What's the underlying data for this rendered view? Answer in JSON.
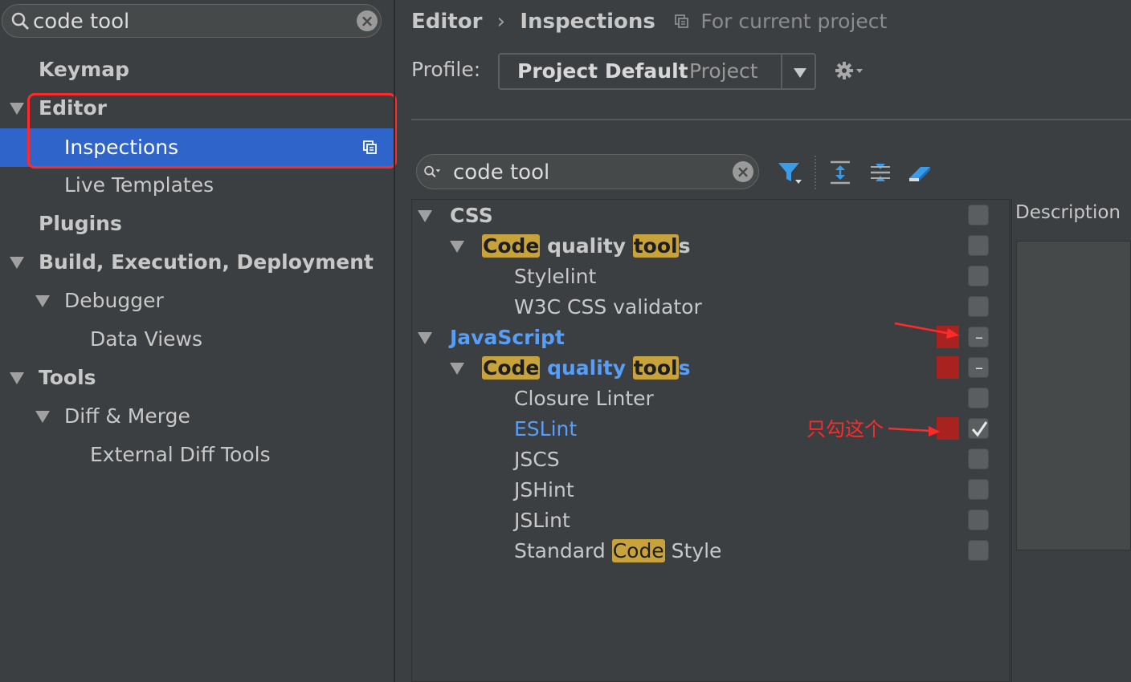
{
  "sidebar": {
    "search": {
      "value": "code tool"
    },
    "items": [
      {
        "label": "Keymap"
      },
      {
        "label": "Editor"
      },
      {
        "label": "Inspections"
      },
      {
        "label": "Live Templates"
      },
      {
        "label": "Plugins"
      },
      {
        "label": "Build, Execution, Deployment"
      },
      {
        "label": "Debugger"
      },
      {
        "label": "Data Views"
      },
      {
        "label": "Tools"
      },
      {
        "label": "Diff & Merge"
      },
      {
        "label": "External Diff Tools"
      }
    ]
  },
  "breadcrumb": {
    "part1": "Editor",
    "separator": "›",
    "part2": "Inspections",
    "scope": "For current project"
  },
  "profile": {
    "label": "Profile:",
    "name": "Project Default",
    "scope": "Project"
  },
  "inspection_search": {
    "value": "code tool"
  },
  "tree": {
    "css": "CSS",
    "code_part": "Code",
    "quality_part": " quality ",
    "tool_part": "tool",
    "s_part": "s",
    "stylelint": "Stylelint",
    "w3c": "W3C CSS validator",
    "javascript": "JavaScript",
    "closure": "Closure Linter",
    "eslint": "ESLint",
    "jscs": "JSCS",
    "jshint": "JSHint",
    "jslint": "JSLint",
    "standard_pre": "Standard ",
    "standard_code": "Code",
    "standard_post": " Style"
  },
  "description_label": "Description",
  "annotation": "只勾这个",
  "colors": {
    "accent_selection": "#2f65ca",
    "highlight_match": "#c8a33c",
    "link_blue": "#589df6",
    "annotation_red": "#ff2a2a"
  }
}
